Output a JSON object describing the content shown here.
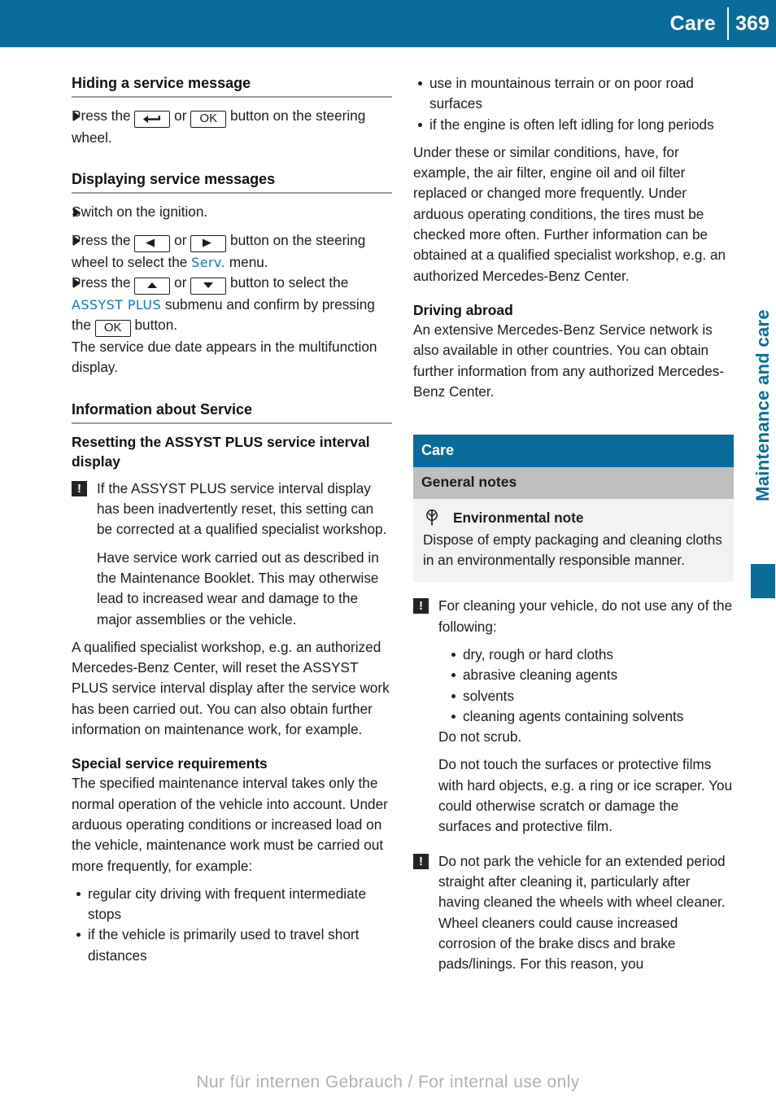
{
  "header": {
    "title": "Care",
    "page_number": "369"
  },
  "side_tab": {
    "label": "Maintenance and care"
  },
  "footer": {
    "text": "Nur für internen Gebrauch / For internal use only"
  },
  "icons": {
    "warning": "!",
    "back_key": "back-arrow",
    "ok_key": "OK",
    "left_key": "◀",
    "right_key": "▶",
    "up_key": "▲",
    "down_key": "▼"
  },
  "colors": {
    "header_blue": "#0a6c9b",
    "display_text_blue": "#1678ac",
    "sub_banner_gray": "#bfbfbf",
    "eco_panel_gray": "#f2f2f2",
    "warning_box": "#232323"
  },
  "left_column": {
    "hiding_heading": "Hiding a service message",
    "hiding_step_pre": "Press the",
    "hiding_step_or": "or",
    "hiding_step_post": "button on the steering wheel.",
    "displaying_heading": "Displaying service messages",
    "displaying_step1": "Switch on the ignition.",
    "displaying_step2_pre": "Press the",
    "displaying_step2_or": "or",
    "displaying_step2_mid": "button on the steering wheel to select the",
    "displaying_step2_menu": "Serv.",
    "displaying_step2_post": "menu.",
    "displaying_step3_pre": "Press the",
    "displaying_step3_or": "or",
    "displaying_step3_mid": "button to select the",
    "displaying_step3_menu": "ASSYST PLUS",
    "displaying_step3_mid2": "submenu and confirm by pressing the",
    "displaying_step3_post": "button.",
    "displaying_step3_result": "The service due date appears in the multifunction display.",
    "info_heading": "Information about Service",
    "resetting_heading": "Resetting the ASSYST PLUS service interval display",
    "resetting_note_1": "If the ASSYST PLUS service interval display has been inadvertently reset, this setting can be corrected at a qualified specialist workshop.",
    "resetting_note_2": "Have service work carried out as described in the Maintenance Booklet. This may otherwise lead to increased wear and damage to the major assemblies or the vehicle.",
    "qualified_para": "A qualified specialist workshop, e.g. an authorized Mercedes-Benz Center, will reset the ASSYST PLUS service interval display after the service work has been carried out. You can also obtain further information on maintenance work, for example.",
    "special_heading": "Special service requirements",
    "special_para": "The specified maintenance interval takes only the normal operation of the vehicle into account. Under arduous operating conditions or increased load on the vehicle, maintenance work must be carried out more frequently, for example:",
    "special_bullets": [
      "regular city driving with frequent intermediate stops",
      "if the vehicle is primarily used to travel short distances"
    ]
  },
  "right_column": {
    "continued_bullets": [
      "use in mountainous terrain or on poor road surfaces",
      "if the engine is often left idling for long periods"
    ],
    "conditions_para": "Under these or similar conditions, have, for example, the air filter, engine oil and oil filter replaced or changed more frequently. Under arduous operating conditions, the tires must be checked more often. Further information can be obtained at a qualified specialist workshop, e.g. an authorized Mercedes-Benz Center.",
    "abroad_heading": "Driving abroad",
    "abroad_para": "An extensive Mercedes-Benz Service network is also available in other countries. You can obtain further information from any authorized Mercedes-Benz Center.",
    "care_banner": "Care",
    "general_notes_banner": "General notes",
    "eco_heading": "Environmental note",
    "eco_body": "Dispose of empty packaging and cleaning cloths in an environmentally responsible manner.",
    "cleaning_note": "For cleaning your vehicle, do not use any of the following:",
    "cleaning_bullets": [
      "dry, rough or hard cloths",
      "abrasive cleaning agents",
      "solvents",
      "cleaning agents containing solvents"
    ],
    "no_scrub": "Do not scrub.",
    "no_touch_para": "Do not touch the surfaces or protective films with hard objects, e.g. a ring or ice scraper. You could otherwise scratch or damage the surfaces and protective film.",
    "parking_note": "Do not park the vehicle for an extended period straight after cleaning it, particularly after having cleaned the wheels with wheel cleaner. Wheel cleaners could cause increased corrosion of the brake discs and brake pads/linings. For this reason, you"
  }
}
